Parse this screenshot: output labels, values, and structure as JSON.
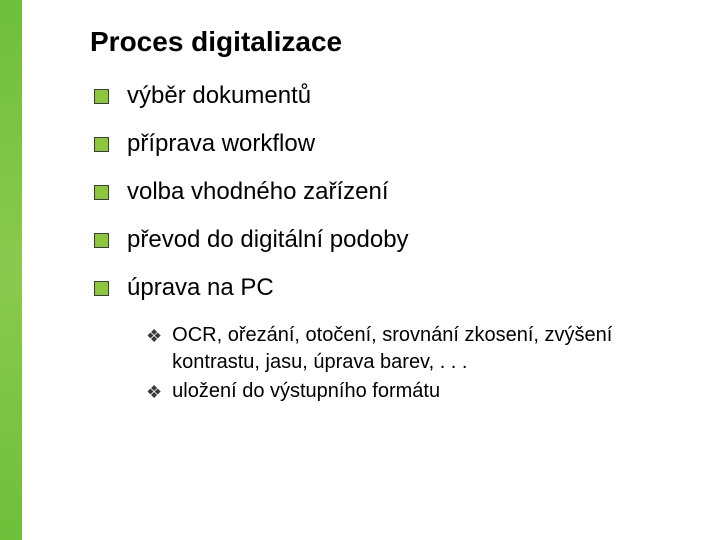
{
  "title": "Proces digitalizace",
  "bullets": [
    {
      "text": "výběr dokumentů"
    },
    {
      "text": "příprava workflow"
    },
    {
      "text": "volba vhodného zařízení"
    },
    {
      "text": "převod do digitální podoby"
    },
    {
      "text": "úprava na PC"
    }
  ],
  "subbullets": [
    {
      "text": "OCR, ořezání, otočení, srovnání zkosení, zvýšení kontrastu, jasu, úprava barev, . . ."
    },
    {
      "text": "uložení do výstupního formátu"
    }
  ]
}
